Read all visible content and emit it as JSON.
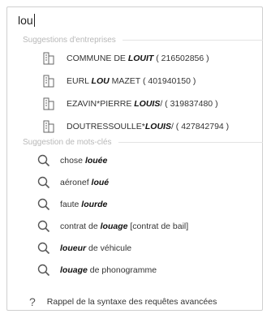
{
  "search": {
    "value": "lou"
  },
  "companies": {
    "header": "Suggestions d'entreprises",
    "items": [
      {
        "pre": "COMMUNE DE ",
        "bold": "LOUIT",
        "post": " ( 216502856 )"
      },
      {
        "pre": "EURL ",
        "bold": "LOU",
        "post": " MAZET ( 401940150 )"
      },
      {
        "pre": "EZAVIN*PIERRE ",
        "bold": "LOUIS",
        "post": "/ ( 319837480 )"
      },
      {
        "pre": "DOUTRESSOULLE*",
        "bold": "LOUIS",
        "post": "/ ( 427842794 )"
      }
    ]
  },
  "keywords": {
    "header": "Suggestion de mots-clés",
    "items": [
      {
        "pre": "chose ",
        "bold": "louée",
        "post": ""
      },
      {
        "pre": "aéronef ",
        "bold": "loué",
        "post": ""
      },
      {
        "pre": "faute ",
        "bold": "lourde",
        "post": ""
      },
      {
        "pre": "contrat de ",
        "bold": "louage",
        "post": " [contrat de bail]"
      },
      {
        "pre": "",
        "bold": "loueur",
        "post": " de véhicule"
      },
      {
        "pre": "",
        "bold": "louage",
        "post": " de phonogramme"
      }
    ]
  },
  "footer": {
    "label": "Rappel de la syntaxe des requêtes avancées"
  },
  "icons": {
    "company": "building-icon",
    "keyword": "search-icon",
    "help": "question-mark-icon"
  }
}
